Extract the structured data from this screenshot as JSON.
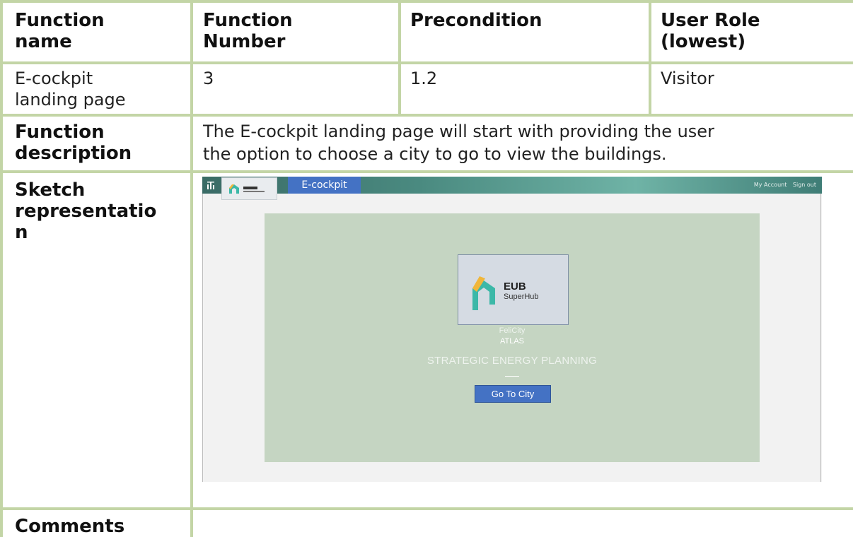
{
  "table": {
    "headers": [
      "Function name",
      "Function Number",
      "Precondition",
      "User Role (lowest)"
    ],
    "header_lines": {
      "c1": [
        "Function",
        "name"
      ],
      "c2": [
        "Function",
        "Number"
      ],
      "c3": [
        "Precondition"
      ],
      "c4": [
        "User Role",
        "(lowest)"
      ]
    },
    "row1": {
      "function_name_lines": [
        "E-cockpit",
        "landing page"
      ],
      "function_number": "3",
      "precondition": "1.2",
      "user_role": "Visitor"
    },
    "description": {
      "label_lines": [
        "Function",
        "description"
      ],
      "text_lines": [
        "The E-cockpit landing page will start with providing the user",
        "the option to choose a city to go to view the buildings."
      ]
    },
    "sketch": {
      "label_lines": [
        "Sketch",
        "representatio",
        "n"
      ]
    },
    "comments": {
      "label": "Comments"
    }
  },
  "sketch_ui": {
    "app_title": "E-cockpit",
    "my_account": "My Account",
    "sign_out": "Sign out",
    "logo_eub": "EUB",
    "logo_superhub": "SuperHub",
    "felicity": "FeliCity",
    "atlas": "ATLAS",
    "tagline": "STRATEGIC ENERGY PLANNING",
    "go_button": "Go To City",
    "icons": [
      "home-icon",
      "eub-superhub-logo"
    ],
    "colors": {
      "top_bar": "#4a8a80",
      "title_tab": "#4472c4",
      "main_panel": "#c5d5c2",
      "button": "#4472c4",
      "table_border": "#c3d5a6"
    }
  }
}
